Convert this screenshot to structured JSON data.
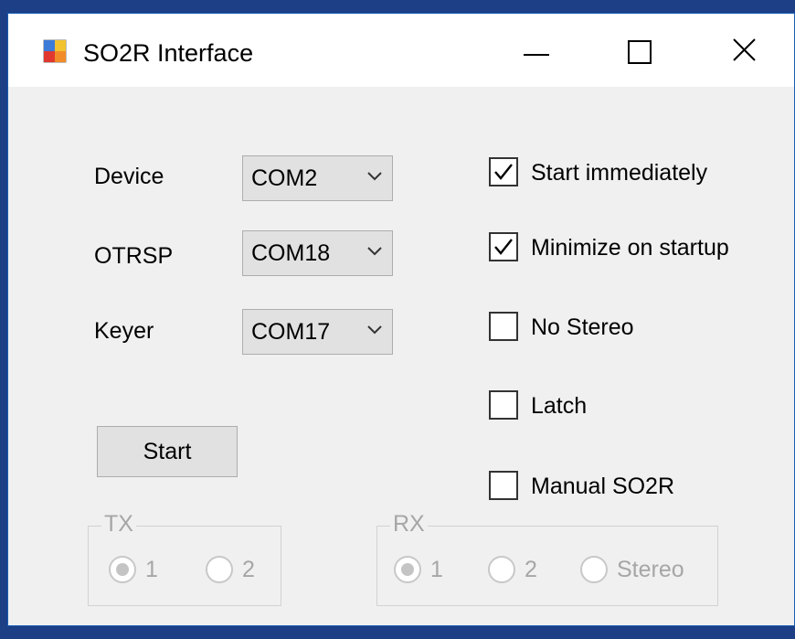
{
  "window": {
    "title": "SO2R Interface",
    "icon": "app-window-icon",
    "controls": [
      "minimize-icon",
      "maximize-icon",
      "close-icon"
    ]
  },
  "ports": {
    "device": {
      "label": "Device",
      "value": "COM2"
    },
    "otrsp": {
      "label": "OTRSP",
      "value": "COM18"
    },
    "keyer": {
      "label": "Keyer",
      "value": "COM17"
    }
  },
  "options": {
    "start_immediately": {
      "label": "Start immediately",
      "checked": true
    },
    "minimize_on_startup": {
      "label": "Minimize on startup",
      "checked": true
    },
    "no_stereo": {
      "label": "No Stereo",
      "checked": false
    },
    "latch": {
      "label": "Latch",
      "checked": false
    },
    "manual_so2r": {
      "label": "Manual SO2R",
      "checked": false
    }
  },
  "start_button": "Start",
  "tx": {
    "label": "TX",
    "options": [
      "1",
      "2"
    ],
    "selected": "1",
    "enabled": false
  },
  "rx": {
    "label": "RX",
    "options": [
      "1",
      "2",
      "Stereo"
    ],
    "selected": "1",
    "enabled": false
  },
  "colors": {
    "desktop": "#1c3f86",
    "dialog": "#f0f0f0",
    "disabled_text": "#a6a6a6"
  }
}
